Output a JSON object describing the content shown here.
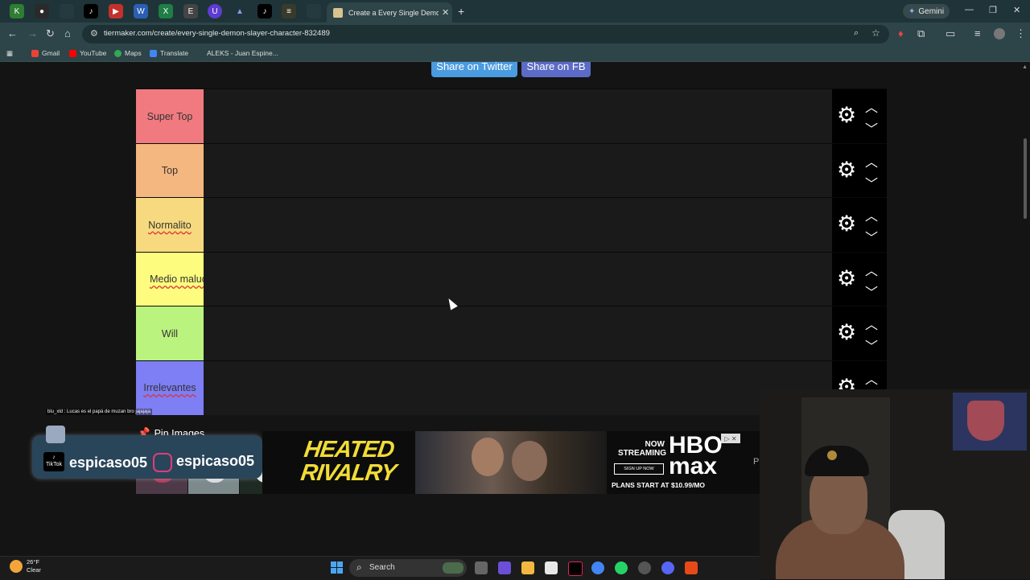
{
  "browser": {
    "active_tab_title": "Create a Every Single Demon Sl",
    "url": "tiermaker.com/create/every-single-demon-slayer-character-832489",
    "gemini_label": "Gemini",
    "bookmarks": [
      "Gmail",
      "YouTube",
      "Maps",
      "Translate",
      "ALEKS - Juan Espine..."
    ]
  },
  "page": {
    "share_twitter": "Share on Twitter",
    "share_fb": "Share on FB",
    "pin_images_label": "Pin Images",
    "tiers": [
      {
        "label": "Super Top",
        "color": "#f07a7f"
      },
      {
        "label": "Top",
        "color": "#f4b77f"
      },
      {
        "label": "Normalito",
        "color": "#f7da7f"
      },
      {
        "label": "Medio maluco",
        "color": "#fdfc7f"
      },
      {
        "label": "Will",
        "color": "#bbf37f"
      },
      {
        "label": "Irrelevantes",
        "color": "#7e7ef5"
      }
    ]
  },
  "stream": {
    "chat_line": "blu_xld : Lucas es el papá de muzan bro jajajaja",
    "tiktok_handle": "espicaso05",
    "instagram_handle": "espicaso05",
    "tiktok_icon_label": "TikTok"
  },
  "ad": {
    "headline": "HEATED RIVALRY",
    "now_streaming": "NOW STREAMING",
    "brand": "HBO max",
    "signup": "SIGN UP NOW",
    "plans": "PLANS START AT $10.99/MO",
    "peek_letter": "P"
  },
  "taskbar": {
    "temperature": "26°F",
    "condition": "Clear",
    "search_label": "Search"
  },
  "colors": {
    "share_twitter": "#4a9be0",
    "share_fb": "#5c6bc7"
  }
}
